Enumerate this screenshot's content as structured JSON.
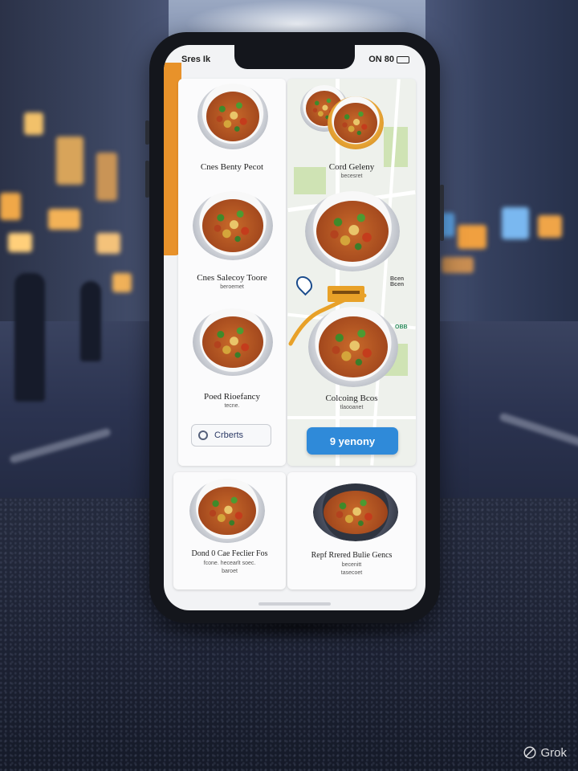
{
  "status_bar": {
    "left": "Sres Ik",
    "right": "ON 80"
  },
  "left_column": {
    "items": [
      {
        "title": "Cnes Benty Pecot",
        "subtitle": ""
      },
      {
        "title": "Cnes Salecoy Toore",
        "subtitle": "beroemet"
      },
      {
        "title": "Poed Rioefancy",
        "subtitle": "tecne."
      }
    ],
    "chip_label": "Crberts"
  },
  "map_column": {
    "items": [
      {
        "title": "Cord Geleny",
        "subtitle": "becesret"
      },
      {
        "title": "Colcoing Bcos",
        "subtitle": "tlaooanet"
      }
    ],
    "map_tags": [
      "Bcen Bcen",
      "OBB"
    ],
    "cta_label": "9 yenony"
  },
  "bottom_cards": [
    {
      "title": "Dond 0 Cae Feclier Fos",
      "lines": [
        "fcone. hecearlt soec.",
        "baroet"
      ]
    },
    {
      "title": "Repf Rrered Bulie Gencs",
      "lines": [
        "becenitt",
        "tasecoet"
      ]
    }
  ],
  "watermark": {
    "label": "Grok"
  },
  "colors": {
    "accent_orange": "#e8922a",
    "cta_blue": "#2f8ad9",
    "park_green": "#cfe3b4"
  }
}
